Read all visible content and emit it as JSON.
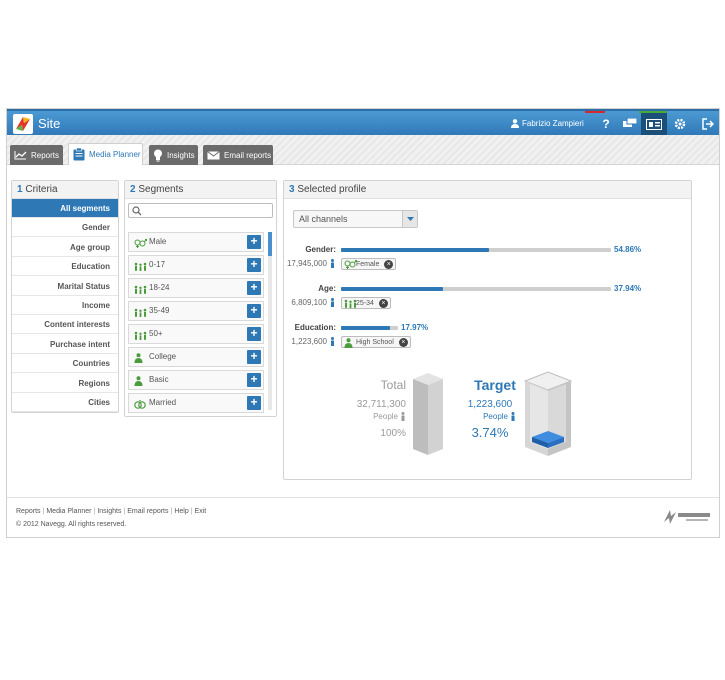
{
  "app": {
    "title": "Site",
    "user_name": "Fabrizio Zampieri",
    "colors": {
      "topbar": "#3a87c6",
      "accent": "#2d78b5",
      "tab_inactive": "#6b6b6b"
    }
  },
  "toolbar": {
    "help_label": "?",
    "icons": [
      "user-icon",
      "help-icon",
      "chat-icon",
      "media-planner-icon",
      "gear-icon",
      "logout-icon"
    ]
  },
  "tabs": [
    {
      "label": "Reports",
      "icon": "line-chart-icon"
    },
    {
      "label": "Media Planner",
      "icon": "clipboard-icon",
      "active": true
    },
    {
      "label": "Insights",
      "icon": "lightbulb-icon"
    },
    {
      "label": "Email reports",
      "icon": "envelope-icon"
    }
  ],
  "criteria": {
    "number": "1",
    "title": "Criteria",
    "items": [
      "All segments",
      "Gender",
      "Age group",
      "Education",
      "Marital Status",
      "Income",
      "Content interests",
      "Purchase intent",
      "Countries",
      "Regions",
      "Cities"
    ],
    "active_index": 0
  },
  "segments": {
    "number": "2",
    "title": "Segments",
    "search_placeholder": "",
    "add_label": "+",
    "items": [
      {
        "label": "Male",
        "icon": "gender-icon"
      },
      {
        "label": "0-17",
        "icon": "age-group-icon"
      },
      {
        "label": "18-24",
        "icon": "age-group-icon"
      },
      {
        "label": "35-49",
        "icon": "age-group-icon"
      },
      {
        "label": "50+",
        "icon": "age-group-icon"
      },
      {
        "label": "College",
        "icon": "education-icon"
      },
      {
        "label": "Basic",
        "icon": "education-icon"
      },
      {
        "label": "Married",
        "icon": "marital-icon"
      }
    ]
  },
  "profile": {
    "number": "3",
    "title": "Selected profile",
    "channel_select": "All channels",
    "metrics": [
      {
        "label": "Gender:",
        "percent_text": "54.86%",
        "fraction": 0.5486,
        "count": "17,945,000",
        "chip": "Female",
        "chip_icon": "gender-icon"
      },
      {
        "label": "Age:",
        "percent_text": "37.94%",
        "fraction": 0.3794,
        "count": "6,809,100",
        "chip": "25-34",
        "chip_icon": "age-group-icon"
      },
      {
        "label": "Education:",
        "percent_text": "17.97%",
        "fraction": 0.1797,
        "count": "1,223,600",
        "chip": "High School",
        "chip_icon": "education-icon"
      }
    ],
    "total": {
      "label": "Total",
      "count": "32,711,300",
      "people_label": "People",
      "percent": "100%"
    },
    "target": {
      "label": "Target",
      "count": "1,223,600",
      "people_label": "People",
      "percent": "3.74%",
      "fraction": 0.0374
    },
    "chip_remove": "×"
  },
  "footer": {
    "links": [
      "Reports",
      "Media Planner",
      "Insights",
      "Email reports",
      "Help",
      "Exit"
    ],
    "separator": "|",
    "copyright": "© 2012 Navegg. All rights reserved.",
    "brand_icon": "navegg-logo-icon"
  }
}
